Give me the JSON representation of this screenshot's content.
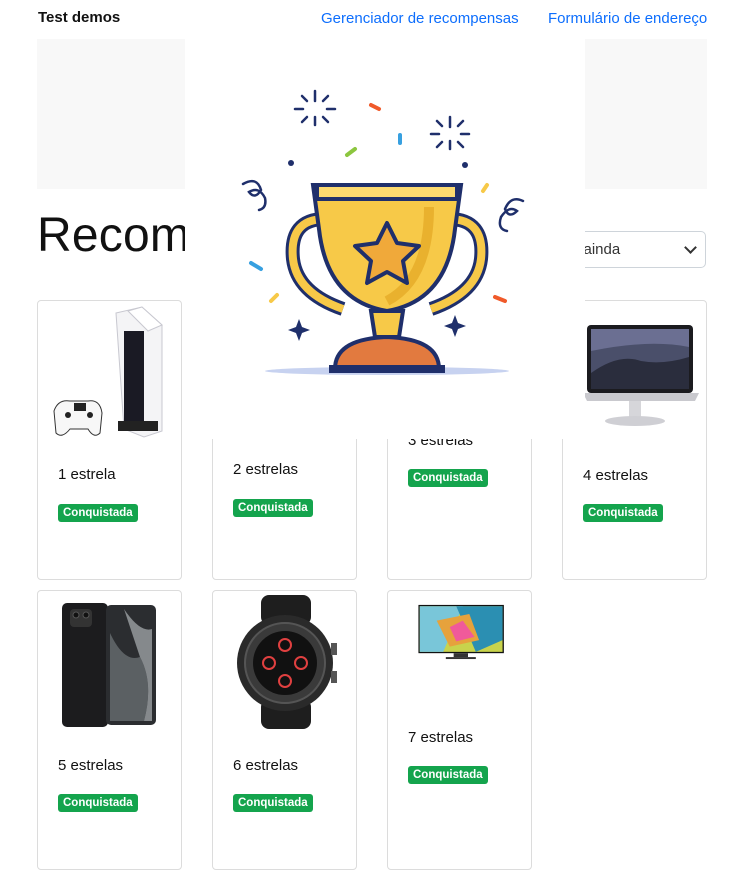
{
  "nav": {
    "brand": "Test demos",
    "links": [
      "Gerenciador de recompensas",
      "Formulário de endereço"
    ]
  },
  "page": {
    "title": "Recom",
    "filter_value": "o ainda"
  },
  "cards": [
    {
      "stars": "1 estrela",
      "badge": "Conquistada",
      "image": "playstation-5"
    },
    {
      "stars": "2 estrelas",
      "badge": "Conquistada",
      "image": "hidden"
    },
    {
      "stars": "3 estrelas",
      "badge": "Conquistada",
      "image": "hidden"
    },
    {
      "stars": "4 estrelas",
      "badge": "Conquistada",
      "image": "macbook"
    },
    {
      "stars": "5 estrelas",
      "badge": "Conquistada",
      "image": "smartphone"
    },
    {
      "stars": "6 estrelas",
      "badge": "Conquistada",
      "image": "smartwatch"
    },
    {
      "stars": "7 estrelas",
      "badge": "Conquistada",
      "image": "qled-tv"
    }
  ],
  "overlay": {
    "icon": "trophy-icon"
  },
  "colors": {
    "link": "#0d6efd",
    "badge": "#14a44d",
    "trophy": "#f7c948"
  }
}
